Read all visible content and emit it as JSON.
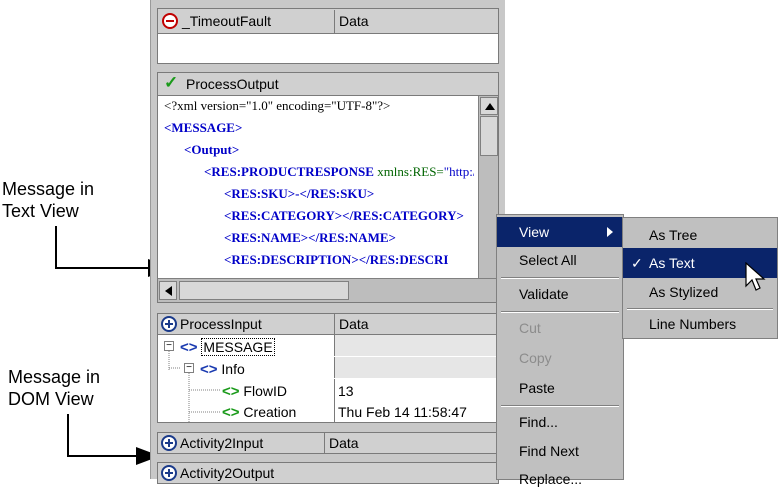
{
  "annotations": {
    "text_view": [
      "Message in",
      "Text View"
    ],
    "dom_view": [
      "Message in",
      "DOM View"
    ]
  },
  "fault_panel": {
    "name": "_TimeoutFault",
    "type": "Data"
  },
  "output_panel": {
    "title": "ProcessOutput",
    "lines": [
      {
        "indent": 0,
        "parts": [
          {
            "t": "plain",
            "v": "<?xml version=\"1.0\" encoding=\"UTF-8\"?>"
          }
        ]
      },
      {
        "indent": 0,
        "parts": [
          {
            "t": "tag",
            "v": "<MESSAGE>"
          }
        ]
      },
      {
        "indent": 1,
        "parts": [
          {
            "t": "tag",
            "v": "<Output>"
          }
        ]
      },
      {
        "indent": 2,
        "parts": [
          {
            "t": "tag",
            "v": "<RES:PRODUCTRESPONSE"
          },
          {
            "t": "attr",
            "v": " xmlns:RES="
          },
          {
            "t": "attrv",
            "v": "\"http://"
          }
        ]
      },
      {
        "indent": 3,
        "parts": [
          {
            "t": "tag",
            "v": "<RES:SKU>-</RES:SKU>"
          }
        ]
      },
      {
        "indent": 3,
        "parts": [
          {
            "t": "tag",
            "v": "<RES:CATEGORY></RES:CATEGORY>"
          }
        ]
      },
      {
        "indent": 3,
        "parts": [
          {
            "t": "tag",
            "v": "<RES:NAME></RES:NAME>"
          }
        ]
      },
      {
        "indent": 3,
        "parts": [
          {
            "t": "tag",
            "v": "<RES:DESCRIPTION></RES:DESCRI"
          }
        ]
      }
    ]
  },
  "input_panel": {
    "name": "ProcessInput",
    "type": "Data",
    "tree": [
      {
        "label": "MESSAGE",
        "value": ""
      },
      {
        "label": "Info",
        "value": ""
      },
      {
        "label": "FlowID",
        "value": "13"
      },
      {
        "label": "Creation",
        "value": "Thu Feb 14 11:58:47"
      }
    ]
  },
  "activity2input": {
    "name": "Activity2Input",
    "type": "Data"
  },
  "activity2output": {
    "name": "Activity2Output"
  },
  "context_menu": {
    "items": [
      {
        "label": "View",
        "enabled": true,
        "submenu": true
      },
      {
        "label": "Select All",
        "enabled": true
      },
      {
        "label": "Validate",
        "enabled": true
      },
      {
        "label": "Cut",
        "enabled": false
      },
      {
        "label": "Copy",
        "enabled": false
      },
      {
        "label": "Paste",
        "enabled": true
      },
      {
        "label": "Find...",
        "enabled": true
      },
      {
        "label": "Find Next",
        "enabled": true
      },
      {
        "label": "Replace...",
        "enabled": true
      }
    ]
  },
  "view_submenu": {
    "items": [
      {
        "label": "As Tree",
        "checked": false
      },
      {
        "label": "As Text",
        "checked": true
      },
      {
        "label": "As Stylized",
        "checked": false
      },
      {
        "label": "Line Numbers",
        "checked": false
      }
    ]
  },
  "colors": {
    "highlight": "#0a246a",
    "tag_blue": "#0000c8",
    "attr_green": "#006400",
    "check_green": "#1a9a1a",
    "fault_red": "#c00000"
  }
}
